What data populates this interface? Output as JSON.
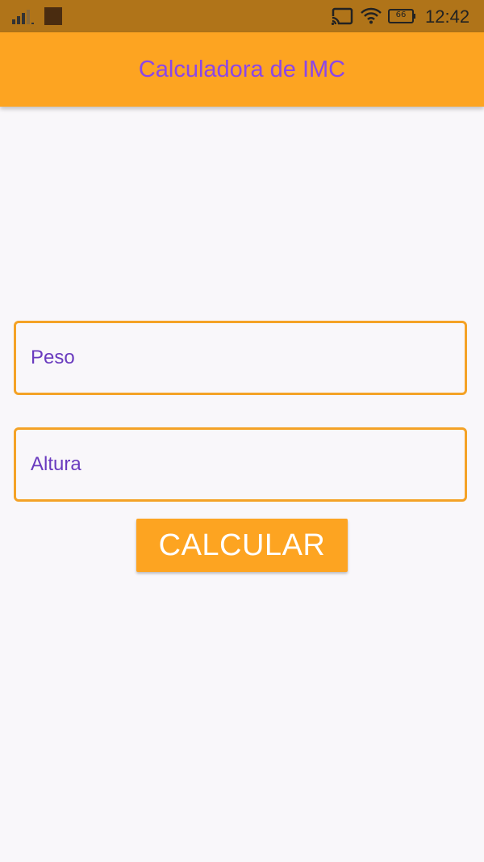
{
  "status_bar": {
    "time": "12:42",
    "battery_level": "66",
    "icons": [
      "signal-icon",
      "app-notification-icon",
      "cast-icon",
      "wifi-icon",
      "battery-icon"
    ]
  },
  "app_bar": {
    "title": "Calculadora de IMC"
  },
  "form": {
    "peso_placeholder": "Peso",
    "peso_value": "",
    "altura_placeholder": "Altura",
    "altura_value": "",
    "calculate_label": "CALCULAR"
  },
  "colors": {
    "status_bar_bg": "#b07419",
    "primary": "#fda421",
    "title_text": "#8b46e8",
    "field_border": "#f4a226",
    "field_text": "#6a3bbf",
    "background": "#f9f7fa",
    "button_text": "#ffffff"
  }
}
